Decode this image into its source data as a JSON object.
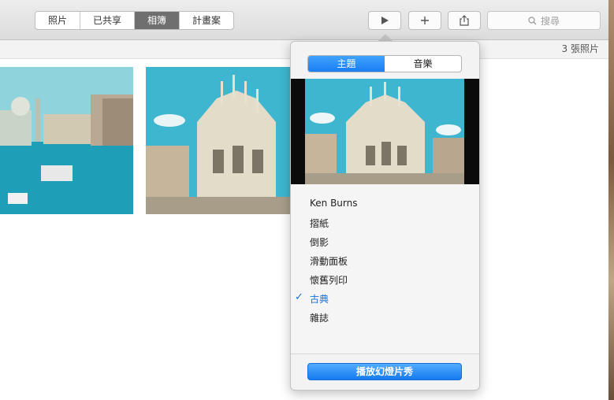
{
  "toolbar": {
    "tabs": [
      {
        "label": "照片"
      },
      {
        "label": "已共享"
      },
      {
        "label": "相簿"
      },
      {
        "label": "計畫案"
      }
    ],
    "selected_tab": "相簿",
    "search_placeholder": "搜尋",
    "icons": {
      "play": "play-icon",
      "add": "plus-icon",
      "share": "share-icon",
      "search": "search-icon"
    }
  },
  "subbar": {
    "count": "3 張照片"
  },
  "popover": {
    "tabs": [
      {
        "label": "主題"
      },
      {
        "label": "音樂"
      }
    ],
    "selected_tab": "主題",
    "themes": [
      {
        "label": "Ken Burns",
        "checked": false
      },
      {
        "label": "摺紙",
        "checked": false
      },
      {
        "label": "倒影",
        "checked": false
      },
      {
        "label": "滑動面板",
        "checked": false
      },
      {
        "label": "懷舊列印",
        "checked": false
      },
      {
        "label": "古典",
        "checked": true
      },
      {
        "label": "雜誌",
        "checked": false
      }
    ],
    "play_button": "播放幻燈片秀"
  },
  "colors": {
    "accent": "#1a7ef2",
    "selected_tab_bg": "#6f6f6f"
  }
}
